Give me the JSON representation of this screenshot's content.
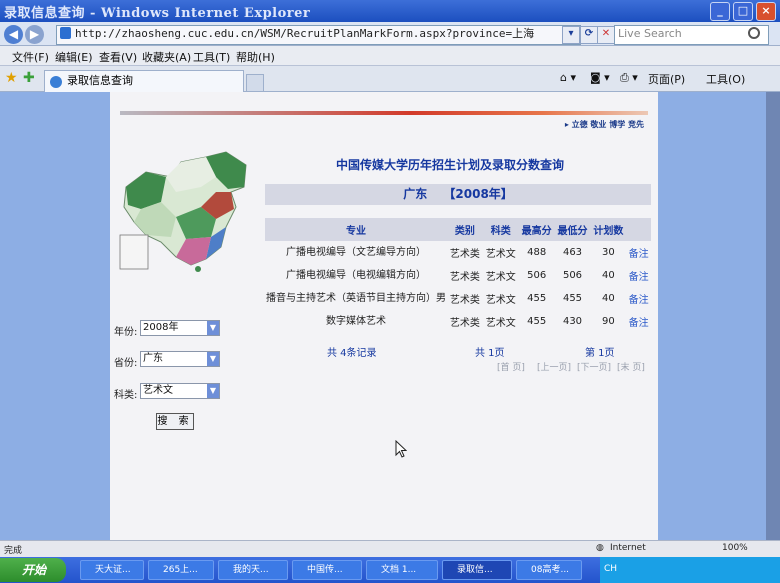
{
  "window": {
    "title": "录取信息查询 - Windows Internet Explorer"
  },
  "address": {
    "url": "http://zhaosheng.cuc.edu.cn/WSM/RecruitPlanMarkForm.aspx?province=上海",
    "search_placeholder": "Live Search"
  },
  "menu": [
    "文件(F)",
    "编辑(E)",
    "查看(V)",
    "收藏夹(A)",
    "工具(T)",
    "帮助(H)"
  ],
  "tab": {
    "label": "录取信息查询"
  },
  "toolbar": {
    "page_label": "页面(P)",
    "tools_label": "工具(O)"
  },
  "page": {
    "toplinks": "▸ 立德 敬业 博学 竞先",
    "title": "中国传媒大学历年招生计划及录取分数查询",
    "province": "广东",
    "year_badge": "【2008年】",
    "table": {
      "headers": [
        "专业",
        "类别",
        "科类",
        "最高分",
        "最低分",
        "计划数",
        ""
      ],
      "rows": [
        [
          "广播电视编导（文艺编导方向）",
          "艺术类",
          "艺术文",
          "488",
          "463",
          "30",
          "备注"
        ],
        [
          "广播电视编导（电视编辑方向）",
          "艺术类",
          "艺术文",
          "506",
          "506",
          "40",
          "备注"
        ],
        [
          "播音与主持艺术（英语节目主持方向）男",
          "艺术类",
          "艺术文",
          "455",
          "455",
          "40",
          "备注"
        ],
        [
          "数字媒体艺术",
          "艺术类",
          "艺术文",
          "455",
          "430",
          "90",
          "备注"
        ]
      ]
    },
    "pager": {
      "records": "共 4条记录",
      "pages": "共 1页",
      "current": "第 1页",
      "first": "[首 页]",
      "prev": "[上一页]",
      "next": "[下一页]",
      "last": "[末 页]"
    },
    "form": {
      "year_label": "年份:",
      "year_value": "2008年",
      "province_label": "省份:",
      "province_value": "广东",
      "category_label": "科类:",
      "category_value": "艺术文",
      "search_button": "搜 索"
    }
  },
  "status": {
    "left": "完成",
    "zone": "Internet",
    "zoom": "100%"
  },
  "taskbar": {
    "start": "开始",
    "tasks": [
      "天大证...",
      "265上...",
      "我的天...",
      "中国传...",
      "文档 1...",
      "录取信...",
      "08高考..."
    ],
    "lang": "CH"
  }
}
